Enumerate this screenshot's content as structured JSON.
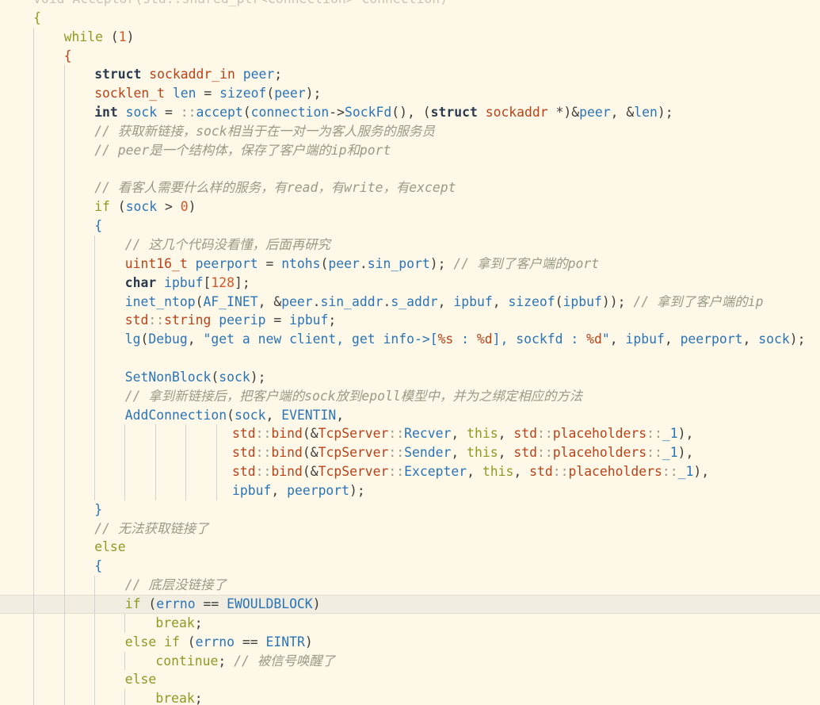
{
  "editor": {
    "language": "cpp",
    "colors": {
      "background": "#fdf8e8",
      "keyword": "#8e9a22",
      "type": "#b94219",
      "function": "#2a74b7",
      "number": "#d4572a",
      "comment": "#9a9a8a",
      "current_line": "#f1ede1"
    },
    "current_line_index": 32,
    "lines": [
      {
        "indent": 0,
        "tokens": [
          [
            "faded",
            "void Acceptor(std::shared_ptr<Connection> connection)"
          ]
        ]
      },
      {
        "indent": 0,
        "tokens": [
          [
            "brace",
            "{"
          ]
        ]
      },
      {
        "indent": 1,
        "tokens": [
          [
            "kw",
            "while"
          ],
          [
            "punc",
            " ("
          ],
          [
            "num",
            "1"
          ],
          [
            "punc",
            ")"
          ]
        ]
      },
      {
        "indent": 1,
        "tokens": [
          [
            "brace2",
            "{"
          ]
        ]
      },
      {
        "indent": 2,
        "tokens": [
          [
            "bold",
            "struct"
          ],
          [
            "punc",
            " "
          ],
          [
            "type",
            "sockaddr_in"
          ],
          [
            "punc",
            " "
          ],
          [
            "var",
            "peer"
          ],
          [
            "punc",
            ";"
          ]
        ]
      },
      {
        "indent": 2,
        "tokens": [
          [
            "type",
            "socklen_t"
          ],
          [
            "punc",
            " "
          ],
          [
            "var",
            "len"
          ],
          [
            "op",
            " = "
          ],
          [
            "fn",
            "sizeof"
          ],
          [
            "punc",
            "("
          ],
          [
            "var",
            "peer"
          ],
          [
            "punc",
            ");"
          ]
        ]
      },
      {
        "indent": 2,
        "tokens": [
          [
            "bold",
            "int"
          ],
          [
            "punc",
            " "
          ],
          [
            "var",
            "sock"
          ],
          [
            "op",
            " = "
          ],
          [
            "scope",
            "::"
          ],
          [
            "fn",
            "accept"
          ],
          [
            "punc",
            "("
          ],
          [
            "var",
            "connection"
          ],
          [
            "op",
            "->"
          ],
          [
            "fn",
            "SockFd"
          ],
          [
            "punc",
            "(), ("
          ],
          [
            "bold",
            "struct"
          ],
          [
            "punc",
            " "
          ],
          [
            "type",
            "sockaddr"
          ],
          [
            "op",
            " *)&"
          ],
          [
            "var",
            "peer"
          ],
          [
            "punc",
            ", "
          ],
          [
            "op",
            "&"
          ],
          [
            "var",
            "len"
          ],
          [
            "punc",
            ");"
          ]
        ]
      },
      {
        "indent": 2,
        "tokens": [
          [
            "com",
            "// 获取新链接，sock相当于在一对一为客人服务的服务员"
          ]
        ]
      },
      {
        "indent": 2,
        "tokens": [
          [
            "com",
            "// peer是一个结构体，保存了客户端的ip和port"
          ]
        ]
      },
      {
        "indent": 2,
        "tokens": []
      },
      {
        "indent": 2,
        "tokens": [
          [
            "com",
            "// 看客人需要什么样的服务，有read，有write，有except"
          ]
        ]
      },
      {
        "indent": 2,
        "tokens": [
          [
            "kw",
            "if"
          ],
          [
            "punc",
            " ("
          ],
          [
            "var",
            "sock"
          ],
          [
            "op",
            " > "
          ],
          [
            "num",
            "0"
          ],
          [
            "punc",
            ")"
          ]
        ]
      },
      {
        "indent": 2,
        "tokens": [
          [
            "brace3",
            "{"
          ]
        ]
      },
      {
        "indent": 3,
        "tokens": [
          [
            "com",
            "// 这几个代码没看懂，后面再研究"
          ]
        ]
      },
      {
        "indent": 3,
        "tokens": [
          [
            "type",
            "uint16_t"
          ],
          [
            "punc",
            " "
          ],
          [
            "var",
            "peerport"
          ],
          [
            "op",
            " = "
          ],
          [
            "fn",
            "ntohs"
          ],
          [
            "punc",
            "("
          ],
          [
            "var",
            "peer"
          ],
          [
            "punc",
            "."
          ],
          [
            "var",
            "sin_port"
          ],
          [
            "punc",
            ");"
          ],
          [
            "punc",
            " "
          ],
          [
            "com",
            "// 拿到了客户端的port"
          ]
        ]
      },
      {
        "indent": 3,
        "tokens": [
          [
            "bold",
            "char"
          ],
          [
            "punc",
            " "
          ],
          [
            "var",
            "ipbuf"
          ],
          [
            "punc",
            "["
          ],
          [
            "num",
            "128"
          ],
          [
            "punc",
            "];"
          ]
        ]
      },
      {
        "indent": 3,
        "tokens": [
          [
            "fn",
            "inet_ntop"
          ],
          [
            "punc",
            "("
          ],
          [
            "var",
            "AF_INET"
          ],
          [
            "punc",
            ", "
          ],
          [
            "op",
            "&"
          ],
          [
            "var",
            "peer"
          ],
          [
            "punc",
            "."
          ],
          [
            "var",
            "sin_addr"
          ],
          [
            "punc",
            "."
          ],
          [
            "var",
            "s_addr"
          ],
          [
            "punc",
            ", "
          ],
          [
            "var",
            "ipbuf"
          ],
          [
            "punc",
            ", "
          ],
          [
            "fn",
            "sizeof"
          ],
          [
            "punc",
            "("
          ],
          [
            "var",
            "ipbuf"
          ],
          [
            "punc",
            "));"
          ],
          [
            "punc",
            " "
          ],
          [
            "com",
            "// 拿到了客户端的ip"
          ]
        ]
      },
      {
        "indent": 3,
        "tokens": [
          [
            "ns",
            "std"
          ],
          [
            "scope",
            "::"
          ],
          [
            "type",
            "string"
          ],
          [
            "punc",
            " "
          ],
          [
            "var",
            "peerip"
          ],
          [
            "op",
            " = "
          ],
          [
            "var",
            "ipbuf"
          ],
          [
            "punc",
            ";"
          ]
        ]
      },
      {
        "indent": 3,
        "tokens": [
          [
            "fn",
            "lg"
          ],
          [
            "punc",
            "("
          ],
          [
            "var",
            "Debug"
          ],
          [
            "punc",
            ", "
          ],
          [
            "str",
            "\"get a new client, get info->["
          ],
          [
            "esc",
            "%s"
          ],
          [
            "str",
            " : "
          ],
          [
            "esc",
            "%d"
          ],
          [
            "str",
            "], sockfd : "
          ],
          [
            "esc",
            "%d"
          ],
          [
            "str",
            "\""
          ],
          [
            "punc",
            ", "
          ],
          [
            "var",
            "ipbuf"
          ],
          [
            "punc",
            ", "
          ],
          [
            "var",
            "peerport"
          ],
          [
            "punc",
            ", "
          ],
          [
            "var",
            "sock"
          ],
          [
            "punc",
            ");"
          ]
        ]
      },
      {
        "indent": 3,
        "tokens": []
      },
      {
        "indent": 3,
        "tokens": [
          [
            "fn",
            "SetNonBlock"
          ],
          [
            "punc",
            "("
          ],
          [
            "var",
            "sock"
          ],
          [
            "punc",
            ");"
          ]
        ]
      },
      {
        "indent": 3,
        "tokens": [
          [
            "com",
            "// 拿到新链接后，把客户端的sock放到epoll模型中，并为之绑定相应的方法"
          ]
        ]
      },
      {
        "indent": 3,
        "tokens": [
          [
            "fn",
            "AddConnection"
          ],
          [
            "punc",
            "("
          ],
          [
            "var",
            "sock"
          ],
          [
            "punc",
            ", "
          ],
          [
            "var",
            "EVENTIN"
          ],
          [
            "punc",
            ","
          ]
        ]
      },
      {
        "indent": 7,
        "offset": 1.5,
        "tokens": [
          [
            "ns",
            "std"
          ],
          [
            "scope",
            "::"
          ],
          [
            "type",
            "bind"
          ],
          [
            "punc",
            "("
          ],
          [
            "op",
            "&"
          ],
          [
            "type",
            "TcpServer"
          ],
          [
            "scope",
            "::"
          ],
          [
            "var",
            "Recver"
          ],
          [
            "punc",
            ", "
          ],
          [
            "kw2",
            "this"
          ],
          [
            "punc",
            ", "
          ],
          [
            "ns",
            "std"
          ],
          [
            "scope",
            "::"
          ],
          [
            "type",
            "placeholders"
          ],
          [
            "scope",
            "::"
          ],
          [
            "var",
            "_1"
          ],
          [
            "punc",
            "),"
          ]
        ]
      },
      {
        "indent": 7,
        "offset": 1.5,
        "tokens": [
          [
            "ns",
            "std"
          ],
          [
            "scope",
            "::"
          ],
          [
            "type",
            "bind"
          ],
          [
            "punc",
            "("
          ],
          [
            "op",
            "&"
          ],
          [
            "type",
            "TcpServer"
          ],
          [
            "scope",
            "::"
          ],
          [
            "var",
            "Sender"
          ],
          [
            "punc",
            ", "
          ],
          [
            "kw2",
            "this"
          ],
          [
            "punc",
            ", "
          ],
          [
            "ns",
            "std"
          ],
          [
            "scope",
            "::"
          ],
          [
            "type",
            "placeholders"
          ],
          [
            "scope",
            "::"
          ],
          [
            "var",
            "_1"
          ],
          [
            "punc",
            "),"
          ]
        ]
      },
      {
        "indent": 7,
        "offset": 1.5,
        "tokens": [
          [
            "ns",
            "std"
          ],
          [
            "scope",
            "::"
          ],
          [
            "type",
            "bind"
          ],
          [
            "punc",
            "("
          ],
          [
            "op",
            "&"
          ],
          [
            "type",
            "TcpServer"
          ],
          [
            "scope",
            "::"
          ],
          [
            "var",
            "Excepter"
          ],
          [
            "punc",
            ", "
          ],
          [
            "kw2",
            "this"
          ],
          [
            "punc",
            ", "
          ],
          [
            "ns",
            "std"
          ],
          [
            "scope",
            "::"
          ],
          [
            "type",
            "placeholders"
          ],
          [
            "scope",
            "::"
          ],
          [
            "var",
            "_1"
          ],
          [
            "punc",
            "),"
          ]
        ]
      },
      {
        "indent": 7,
        "offset": 1.5,
        "tokens": [
          [
            "var",
            "ipbuf"
          ],
          [
            "punc",
            ", "
          ],
          [
            "var",
            "peerport"
          ],
          [
            "punc",
            ");"
          ]
        ]
      },
      {
        "indent": 2,
        "tokens": [
          [
            "brace3",
            "}"
          ]
        ]
      },
      {
        "indent": 2,
        "tokens": [
          [
            "com",
            "// 无法获取链接了"
          ]
        ]
      },
      {
        "indent": 2,
        "tokens": [
          [
            "kw",
            "else"
          ]
        ]
      },
      {
        "indent": 2,
        "tokens": [
          [
            "brace3",
            "{"
          ]
        ]
      },
      {
        "indent": 3,
        "tokens": [
          [
            "com",
            "// 底层没链接了"
          ]
        ]
      },
      {
        "indent": 3,
        "tokens": [
          [
            "kw",
            "if"
          ],
          [
            "punc",
            " ("
          ],
          [
            "var",
            "errno"
          ],
          [
            "op",
            " == "
          ],
          [
            "var",
            "EWOULDBLOCK"
          ],
          [
            "punc",
            ")"
          ]
        ]
      },
      {
        "indent": 4,
        "tokens": [
          [
            "kw",
            "break"
          ],
          [
            "punc",
            ";"
          ]
        ]
      },
      {
        "indent": 3,
        "tokens": [
          [
            "kw",
            "else"
          ],
          [
            "punc",
            " "
          ],
          [
            "kw",
            "if"
          ],
          [
            "punc",
            " ("
          ],
          [
            "var",
            "errno"
          ],
          [
            "op",
            " == "
          ],
          [
            "var",
            "EINTR"
          ],
          [
            "punc",
            ")"
          ]
        ]
      },
      {
        "indent": 4,
        "tokens": [
          [
            "kw",
            "continue"
          ],
          [
            "punc",
            "; "
          ],
          [
            "com",
            "// 被信号唤醒了"
          ]
        ]
      },
      {
        "indent": 3,
        "tokens": [
          [
            "kw",
            "else"
          ]
        ]
      },
      {
        "indent": 4,
        "tokens": [
          [
            "kw",
            "break"
          ],
          [
            "punc",
            ";"
          ]
        ]
      }
    ]
  }
}
